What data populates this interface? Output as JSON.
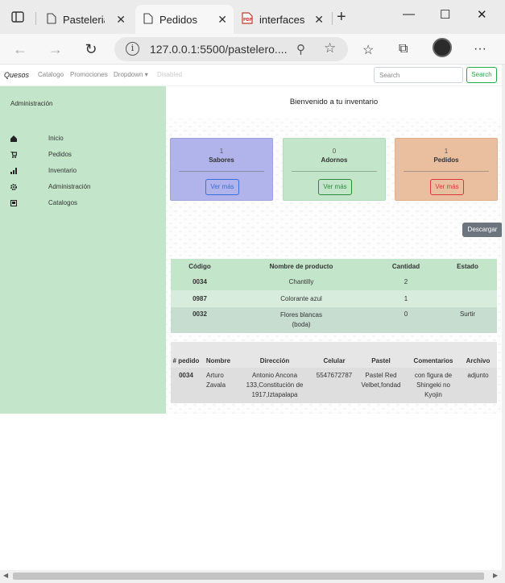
{
  "browser": {
    "tabs": [
      {
        "title": "Pasteleria",
        "close": "✕"
      },
      {
        "title": "Pedidos",
        "close": "✕"
      },
      {
        "title": "interfaces",
        "close": "✕"
      }
    ],
    "url": "127.0.0.1:5500/pastelero....",
    "new_tab": "+",
    "window_controls": {
      "minimize": "—",
      "maximize": "☐",
      "close": "✕"
    }
  },
  "navbar": {
    "brand": "Quesos",
    "links": [
      "Catalogo",
      "Promociones",
      "Dropdown ▾",
      "Disabled"
    ],
    "search_placeholder": "Search",
    "search_button": "Search"
  },
  "sidebar": {
    "heading": "Administración",
    "items": [
      {
        "label": "Inicio",
        "icon": "home-icon"
      },
      {
        "label": "Pedidos",
        "icon": "cart-icon"
      },
      {
        "label": "Inventario",
        "icon": "chart-icon"
      },
      {
        "label": "Administración",
        "icon": "gear-icon"
      },
      {
        "label": "Catalogos",
        "icon": "book-icon"
      }
    ]
  },
  "main": {
    "welcome": "Bienvenido a tu inventario",
    "cards": [
      {
        "count": "1",
        "title": "Sabores",
        "button": "Ver más",
        "color": "#b0b4ea"
      },
      {
        "count": "0",
        "title": "Adornos",
        "button": "Ver más",
        "color": "#c3e6cb"
      },
      {
        "count": "1",
        "title": "Pedidos",
        "button": "Ver más",
        "color": "#eabf9f"
      }
    ],
    "download_button": "Descargar"
  },
  "inventory_table": {
    "headers": [
      "Código",
      "Nombre de producto",
      "Cantidad",
      "Estado"
    ],
    "rows": [
      {
        "code": "0034",
        "name": "Chantilly",
        "qty": "2",
        "status": ""
      },
      {
        "code": "0987",
        "name": "Colorante azul",
        "qty": "1",
        "status": ""
      },
      {
        "code": "0032",
        "name": "Flores blancas (boda)",
        "qty": "0",
        "status": "Surtir"
      }
    ]
  },
  "orders_table": {
    "headers": [
      "# pedido",
      "Nombre",
      "Dirección",
      "Celular",
      "Pastel",
      "Comentarios",
      "Archivo"
    ],
    "rows": [
      {
        "id": "0034",
        "name": "Arturo Zavala",
        "address": "Antonio Ancona 133,Constitución de 1917,Iztapalapa",
        "phone": "5547672787",
        "cake": "Pastel Red Velbet,fondad",
        "comments": "con figura de Shingeki no Kyojin",
        "file": "adjunto"
      }
    ]
  }
}
